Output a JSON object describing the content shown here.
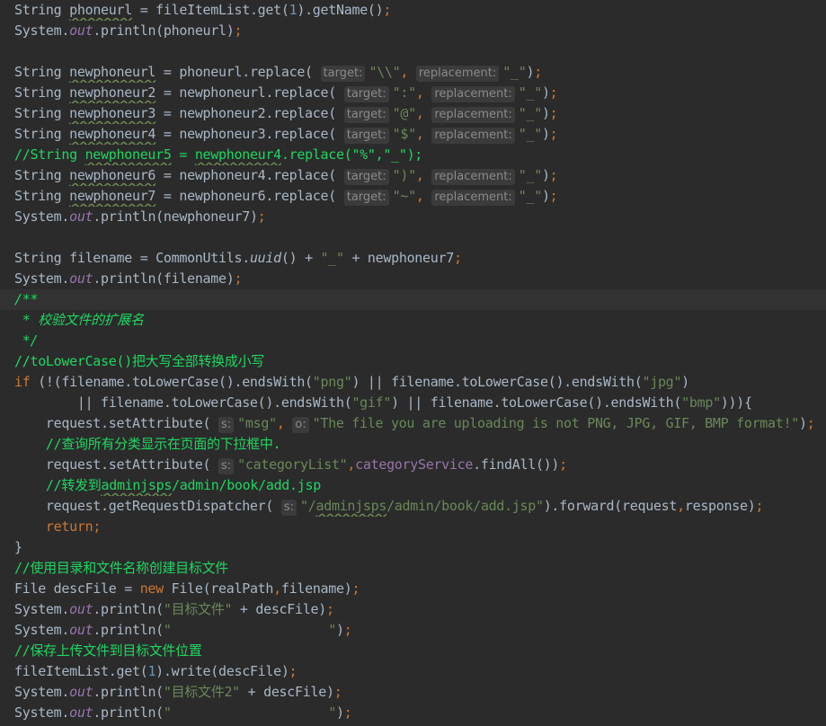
{
  "editor": {
    "current_line": 14,
    "colors": {
      "background": "#2b2b2b",
      "current_line": "#323232",
      "keyword": "#cc7832",
      "string": "#6a8759",
      "number": "#6897bb",
      "field": "#9876aa",
      "comment": "#1ed760",
      "plain": "#a9b7c6",
      "hint_bg": "#3b3b3b",
      "hint_text": "#8a8a8a"
    },
    "lines": [
      [
        [
          "plain",
          "String "
        ],
        [
          "under",
          "phoneurl"
        ],
        [
          "plain",
          " = fileItemList.get("
        ],
        [
          "num",
          "1"
        ],
        [
          "plain",
          ").getName()"
        ],
        [
          "punct",
          ";"
        ]
      ],
      [
        [
          "plain",
          "System."
        ],
        [
          "field",
          "out"
        ],
        [
          "plain",
          ".println(phoneurl)"
        ],
        [
          "punct",
          ";"
        ]
      ],
      [],
      [
        [
          "plain",
          "String "
        ],
        [
          "under",
          "newphoneurl"
        ],
        [
          "plain",
          " = phoneurl.replace( "
        ],
        [
          "hint",
          "target:"
        ],
        [
          "str",
          "\"\\\\\""
        ],
        [
          "punct",
          ", "
        ],
        [
          "hint",
          "replacement:"
        ],
        [
          "str",
          "\"_\""
        ],
        [
          "plain",
          ")"
        ],
        [
          "punct",
          ";"
        ]
      ],
      [
        [
          "plain",
          "String "
        ],
        [
          "under",
          "newphoneur2"
        ],
        [
          "plain",
          " = newphoneurl.replace( "
        ],
        [
          "hint",
          "target:"
        ],
        [
          "str",
          "\":\""
        ],
        [
          "punct",
          ", "
        ],
        [
          "hint",
          "replacement:"
        ],
        [
          "str",
          "\"_\""
        ],
        [
          "plain",
          ")"
        ],
        [
          "punct",
          ";"
        ]
      ],
      [
        [
          "plain",
          "String "
        ],
        [
          "under",
          "newphoneur3"
        ],
        [
          "plain",
          " = newphoneur2.replace( "
        ],
        [
          "hint",
          "target:"
        ],
        [
          "str",
          "\"@\""
        ],
        [
          "punct",
          ", "
        ],
        [
          "hint",
          "replacement:"
        ],
        [
          "str",
          "\"_\""
        ],
        [
          "plain",
          ")"
        ],
        [
          "punct",
          ";"
        ]
      ],
      [
        [
          "plain",
          "String "
        ],
        [
          "under",
          "newphoneur4"
        ],
        [
          "plain",
          " = newphoneur3.replace( "
        ],
        [
          "hint",
          "target:"
        ],
        [
          "str",
          "\"$\""
        ],
        [
          "punct",
          ", "
        ],
        [
          "hint",
          "replacement:"
        ],
        [
          "str",
          "\"_\""
        ],
        [
          "plain",
          ")"
        ],
        [
          "punct",
          ";"
        ]
      ],
      [
        [
          "comment",
          "//String "
        ],
        [
          "comment_under",
          "newphoneur5"
        ],
        [
          "comment",
          " = "
        ],
        [
          "comment_under",
          "newphoneur4"
        ],
        [
          "comment",
          ".replace(\"%\",\"_\");"
        ]
      ],
      [
        [
          "plain",
          "String "
        ],
        [
          "under",
          "newphoneur6"
        ],
        [
          "plain",
          " = newphoneur4.replace( "
        ],
        [
          "hint",
          "target:"
        ],
        [
          "str",
          "\")\""
        ],
        [
          "punct",
          ", "
        ],
        [
          "hint",
          "replacement:"
        ],
        [
          "str",
          "\"_\""
        ],
        [
          "plain",
          ")"
        ],
        [
          "punct",
          ";"
        ]
      ],
      [
        [
          "plain",
          "String "
        ],
        [
          "under",
          "newphoneur7"
        ],
        [
          "plain",
          " = newphoneur6.replace( "
        ],
        [
          "hint",
          "target:"
        ],
        [
          "str",
          "\"~\""
        ],
        [
          "punct",
          ", "
        ],
        [
          "hint",
          "replacement:"
        ],
        [
          "str",
          "\"_\""
        ],
        [
          "plain",
          ")"
        ],
        [
          "punct",
          ";"
        ]
      ],
      [
        [
          "plain",
          "System."
        ],
        [
          "field",
          "out"
        ],
        [
          "plain",
          ".println(newphoneur7)"
        ],
        [
          "punct",
          ";"
        ]
      ],
      [],
      [
        [
          "plain",
          "String filename = CommonUtils."
        ],
        [
          "static",
          "uuid"
        ],
        [
          "plain",
          "() + "
        ],
        [
          "str",
          "\"_\""
        ],
        [
          "plain",
          " + newphoneur7"
        ],
        [
          "punct",
          ";"
        ]
      ],
      [
        [
          "plain",
          "System."
        ],
        [
          "field",
          "out"
        ],
        [
          "plain",
          ".println(filename)"
        ],
        [
          "punct",
          ";"
        ]
      ],
      [
        [
          "doc",
          "/**"
        ]
      ],
      [
        [
          "doc",
          " * 校验文件的扩展名"
        ]
      ],
      [
        [
          "doc",
          " */"
        ]
      ],
      [
        [
          "comment",
          "//toLowerCase()把大写全部转换成小写"
        ]
      ],
      [
        [
          "kw",
          "if "
        ],
        [
          "plain",
          "(!(filename.toLowerCase().endsWith("
        ],
        [
          "str",
          "\"png\""
        ],
        [
          "plain",
          ") || filename.toLowerCase().endsWith("
        ],
        [
          "str",
          "\"jpg\""
        ],
        [
          "plain",
          ")"
        ]
      ],
      [
        [
          "plain",
          "        || filename.toLowerCase().endsWith("
        ],
        [
          "str",
          "\"gif\""
        ],
        [
          "plain",
          ") || filename.toLowerCase().endsWith("
        ],
        [
          "str",
          "\"bmp\""
        ],
        [
          "plain",
          ")))"
        ],
        [
          "plain",
          "{"
        ]
      ],
      [
        [
          "plain",
          "    request.setAttribute( "
        ],
        [
          "hint",
          "s:"
        ],
        [
          "str",
          "\"msg\""
        ],
        [
          "punct",
          ", "
        ],
        [
          "hint",
          "o:"
        ],
        [
          "str",
          "\"The file you are uploading is not PNG, JPG, GIF, BMP format!\""
        ],
        [
          "plain",
          ")"
        ],
        [
          "punct",
          ";"
        ]
      ],
      [
        [
          "comment",
          "    //查询所有分类显示在页面的下拉框中."
        ]
      ],
      [
        [
          "plain",
          "    request.setAttribute( "
        ],
        [
          "hint",
          "s:"
        ],
        [
          "str",
          "\"categoryList\""
        ],
        [
          "punct",
          ","
        ],
        [
          "member",
          "categoryService"
        ],
        [
          "plain",
          ".findAll())"
        ],
        [
          "punct",
          ";"
        ]
      ],
      [
        [
          "comment",
          "    //转发到"
        ],
        [
          "comment_under",
          "adminjsps"
        ],
        [
          "comment",
          "/admin/book/add.jsp"
        ]
      ],
      [
        [
          "plain",
          "    request.getRequestDispatcher( "
        ],
        [
          "hint",
          "s:"
        ],
        [
          "str",
          "\"/"
        ],
        [
          "str_under",
          "adminjsps"
        ],
        [
          "str",
          "/admin/book/add.jsp\""
        ],
        [
          "plain",
          ").forward(request"
        ],
        [
          "punct",
          ","
        ],
        [
          "plain",
          "response)"
        ],
        [
          "punct",
          ";"
        ]
      ],
      [
        [
          "kw",
          "    return"
        ],
        [
          "punct",
          ";"
        ]
      ],
      [
        [
          "plain",
          "}"
        ]
      ],
      [
        [
          "comment",
          "//使用目录和文件名称创建目标文件"
        ]
      ],
      [
        [
          "plain",
          "File descFile = "
        ],
        [
          "kw",
          "new "
        ],
        [
          "plain",
          "File(realPath"
        ],
        [
          "punct",
          ","
        ],
        [
          "plain",
          "filename)"
        ],
        [
          "punct",
          ";"
        ]
      ],
      [
        [
          "plain",
          "System."
        ],
        [
          "field",
          "out"
        ],
        [
          "plain",
          ".println("
        ],
        [
          "str",
          "\"目标文件\""
        ],
        [
          "plain",
          " + descFile)"
        ],
        [
          "punct",
          ";"
        ]
      ],
      [
        [
          "plain",
          "System."
        ],
        [
          "field",
          "out"
        ],
        [
          "plain",
          ".println("
        ],
        [
          "str",
          "\"                    \""
        ],
        [
          "plain",
          ")"
        ],
        [
          "punct",
          ";"
        ]
      ],
      [
        [
          "comment",
          "//保存上传文件到目标文件位置"
        ]
      ],
      [
        [
          "plain",
          "fileItemList.get("
        ],
        [
          "num",
          "1"
        ],
        [
          "plain",
          ").write(descFile)"
        ],
        [
          "punct",
          ";"
        ]
      ],
      [
        [
          "plain",
          "System."
        ],
        [
          "field",
          "out"
        ],
        [
          "plain",
          ".println("
        ],
        [
          "str",
          "\"目标文件2\""
        ],
        [
          "plain",
          " + descFile)"
        ],
        [
          "punct",
          ";"
        ]
      ],
      [
        [
          "plain",
          "System."
        ],
        [
          "field",
          "out"
        ],
        [
          "plain",
          ".println("
        ],
        [
          "str",
          "\"                    \""
        ],
        [
          "plain",
          ")"
        ],
        [
          "punct",
          ";"
        ]
      ]
    ]
  }
}
